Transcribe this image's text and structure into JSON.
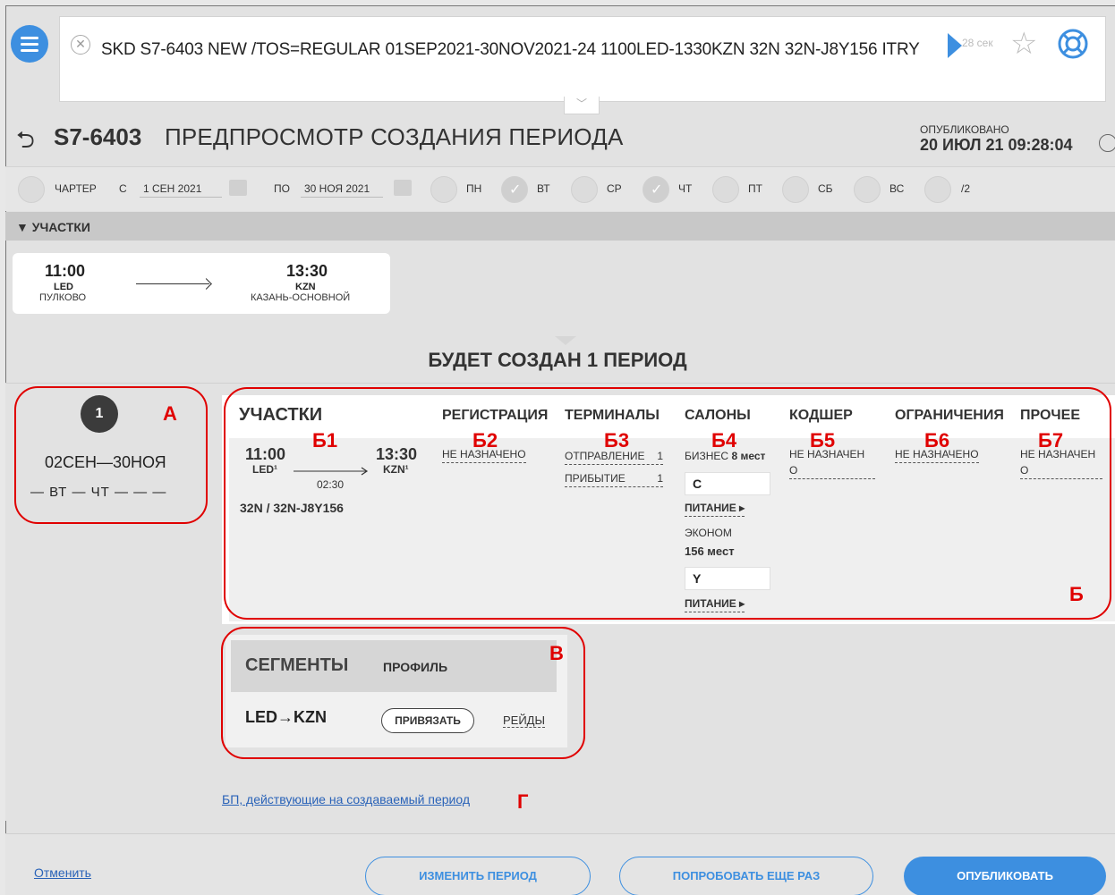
{
  "command": {
    "text": "SKD S7-6403 NEW /TOS=REGULAR 01SEP2021-30NOV2021-24 1100LED-1330KZN 32N 32N-J8Y156 ITRY",
    "timer": "28 сек"
  },
  "header": {
    "flight": "S7-6403",
    "title": "ПРЕДПРОСМОТР СОЗДАНИЯ ПЕРИОДА",
    "published_label": "ОПУБЛИКОВАНО",
    "published_value": "20 ИЮЛ 21 09:28:04"
  },
  "filters": {
    "charter": "ЧАРТЕР",
    "from_label": "С",
    "from_date": "1 СЕН 2021",
    "to_label": "ПО",
    "to_date": "30 НОЯ 2021",
    "days": [
      {
        "label": "ПН",
        "checked": false
      },
      {
        "label": "ВТ",
        "checked": true
      },
      {
        "label": "СР",
        "checked": false
      },
      {
        "label": "ЧТ",
        "checked": true
      },
      {
        "label": "ПТ",
        "checked": false
      },
      {
        "label": "СБ",
        "checked": false
      },
      {
        "label": "ВС",
        "checked": false
      },
      {
        "label": "/2",
        "checked": false
      }
    ]
  },
  "legs_strip": "▼ УЧАСТКИ",
  "leg": {
    "dep_time": "11:00",
    "dep_code": "LED",
    "dep_name": "ПУЛКОВО",
    "arr_time": "13:30",
    "arr_code": "KZN",
    "arr_name": "КАЗАНЬ-ОСНОВНОЙ"
  },
  "will_create": "БУДЕТ СОЗДАН 1 ПЕРИОД",
  "period": {
    "number": "1",
    "dates": "02СЕН—30НОЯ",
    "days": "— ВТ — ЧТ — — —"
  },
  "details": {
    "headers": {
      "legs": "УЧАСТКИ",
      "registration": "РЕГИСТРАЦИЯ",
      "terminals": "ТЕРМИНАЛЫ",
      "cabins": "САЛОНЫ",
      "codeshare": "КОДШЕР",
      "restrictions": "ОГРАНИЧЕНИЯ",
      "other": "ПРОЧЕЕ"
    },
    "leg": {
      "dep_time": "11:00",
      "dep_code": "LED¹",
      "arr_time": "13:30",
      "arr_code": "KZN¹",
      "duration": "02:30",
      "equipment": "32N / 32N-J8Y156"
    },
    "registration": "НЕ НАЗНАЧЕНО",
    "terminals": {
      "departure_label": "ОТПРАВЛЕНИЕ",
      "departure_value": "1",
      "arrival_label": "ПРИБЫТИЕ",
      "arrival_value": "1"
    },
    "cabins": {
      "business_label": "БИЗНЕС",
      "business_seats": "8 мест",
      "business_class": "C",
      "meal1": "ПИТАНИЕ ▸",
      "economy_label": "ЭКОНОМ",
      "economy_seats": "156 мест",
      "economy_class": "Y",
      "meal2": "ПИТАНИЕ ▸"
    },
    "codeshare_l1": "НЕ НАЗНАЧЕН",
    "codeshare_l2": "О",
    "restrictions": "НЕ НАЗНАЧЕНО",
    "other_l1": "НЕ НАЗНАЧЕН",
    "other_l2": "О"
  },
  "segments": {
    "title": "СЕГМЕНТЫ",
    "profile": "ПРОФИЛЬ",
    "route": "LED→KZN",
    "bind": "ПРИВЯЗАТЬ",
    "flights": "РЕЙДЫ"
  },
  "bp_link": "БП, действующие на создаваемый период",
  "annotations": {
    "a": "А",
    "b": "Б",
    "b1": "Б1",
    "b2": "Б2",
    "b3": "Б3",
    "b4": "Б4",
    "b5": "Б5",
    "b6": "Б6",
    "b7": "Б7",
    "v": "В",
    "g": "Г"
  },
  "footer": {
    "cancel": "Отменить",
    "change": "ИЗМЕНИТЬ ПЕРИОД",
    "retry": "ПОПРОБОВАТЬ ЕЩЕ РАЗ",
    "publish": "ОПУБЛИКОВАТЬ"
  },
  "colors": {
    "accent": "#3d8fe0",
    "annotation": "#e00000"
  }
}
